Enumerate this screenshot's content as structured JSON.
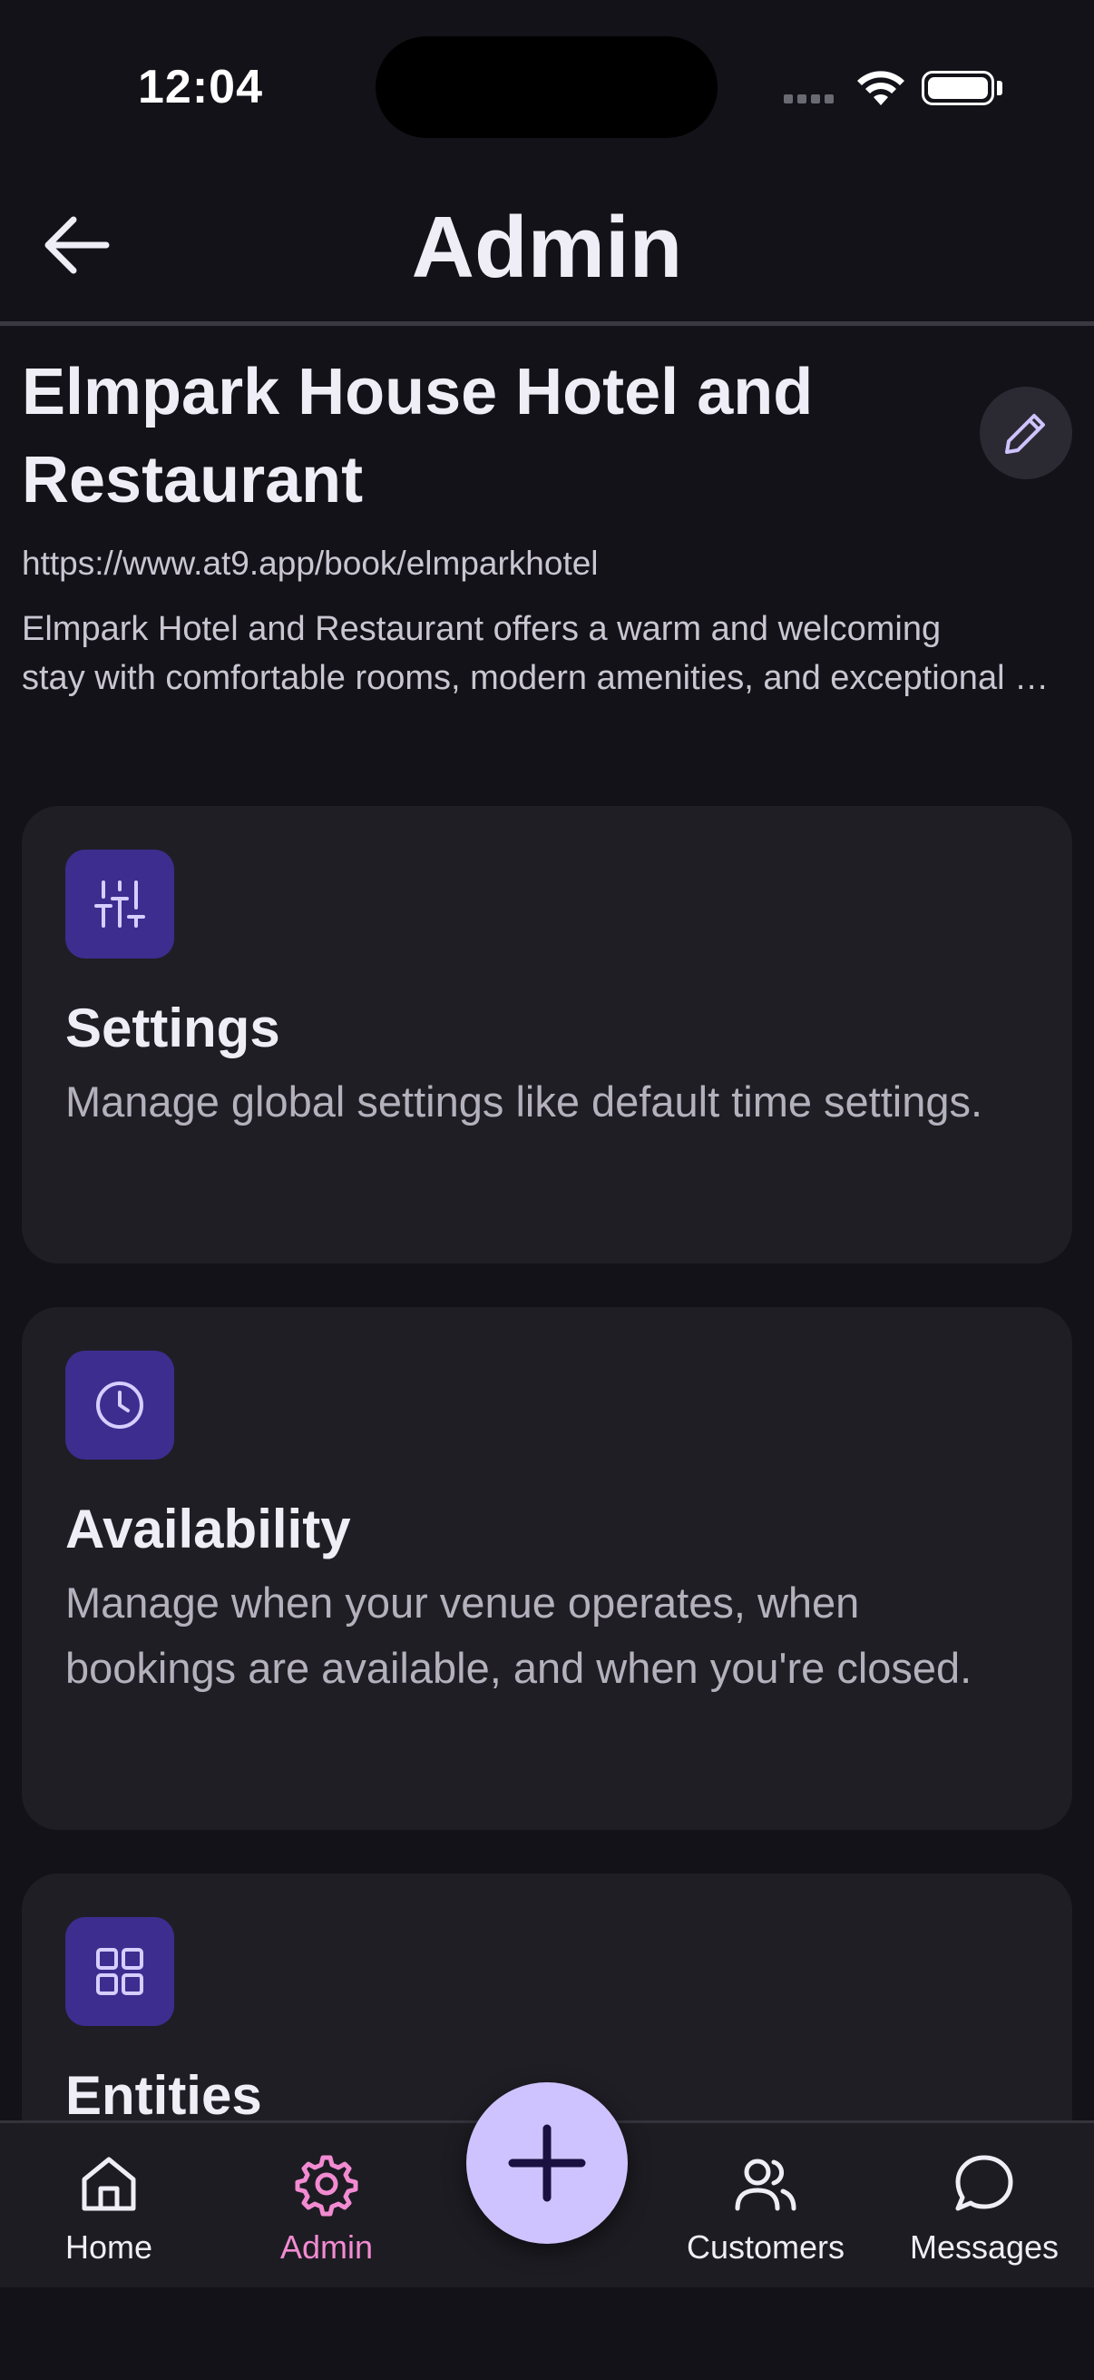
{
  "status_bar": {
    "time": "12:04"
  },
  "header": {
    "title": "Admin"
  },
  "venue": {
    "name": "Elmpark House Hotel and Restaurant",
    "url": "https://www.at9.app/book/elmparkhotel",
    "description_line1": "Elmpark Hotel and Restaurant offers a warm and welcoming",
    "description_line2": "stay with comfortable rooms, modern amenities, and exceptional hospitality"
  },
  "cards": [
    {
      "title": "Settings",
      "description": "Manage global settings like default time settings.",
      "icon": "sliders-icon"
    },
    {
      "title": "Availability",
      "description": "Manage when your venue operates, when bookings are available, and when you're closed.",
      "icon": "clock-icon"
    },
    {
      "title": "Entities",
      "description": "",
      "icon": "grid-icon"
    }
  ],
  "nav": {
    "home": "Home",
    "admin": "Admin",
    "customers": "Customers",
    "messages": "Messages"
  },
  "colors": {
    "background": "#131218",
    "card": "#1f1e25",
    "icon_tile": "#3d2d8f",
    "accent": "#cfc3ff",
    "active_tab": "#f28bd2"
  }
}
